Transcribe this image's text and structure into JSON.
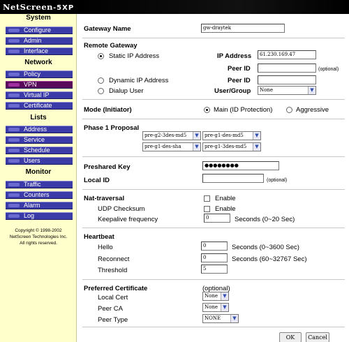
{
  "header": {
    "brand": "NetScreen",
    "model": "-5XP"
  },
  "sidebar": {
    "sections": [
      {
        "title": "System",
        "items": [
          "Configure",
          "Admin",
          "Interface"
        ]
      },
      {
        "title": "Network",
        "items": [
          "Policy",
          "VPN",
          "Virtual IP",
          "Certificate"
        ]
      },
      {
        "title": "Lists",
        "items": [
          "Address",
          "Service",
          "Schedule",
          "Users"
        ]
      },
      {
        "title": "Monitor",
        "items": [
          "Traffic",
          "Counters",
          "Alarm",
          "Log"
        ]
      }
    ],
    "active_item": "VPN",
    "copyright": [
      "Copyright © 1998-2002",
      "NetScreen Technologies Inc.",
      "All rights reserved."
    ]
  },
  "form": {
    "gateway_name_label": "Gateway Name",
    "gateway_name_value": "gw-draytek",
    "remote_gateway_label": "Remote Gateway",
    "static_ip_label": "Static IP Address",
    "ip_address_label": "IP Address",
    "ip_address_value": "61.230.169.47",
    "peer_id_label": "Peer ID",
    "optional_label": "(optional)",
    "dynamic_ip_label": "Dynamic IP Address",
    "peer_id_label_2": "Peer ID",
    "dialup_user_label": "Dialup User",
    "user_group_label": "User/Group",
    "user_group_value": "None",
    "mode_label": "Mode (Initiator)",
    "mode_main": "Main (ID Protection)",
    "mode_aggressive": "Aggressive",
    "phase1_label": "Phase 1 Proposal",
    "proposals": [
      "pre-g2-3des-md5",
      "pre-g1-des-md5",
      "pre-g1-des-sha",
      "pre-g1-3des-md5"
    ],
    "preshared_key_label": "Preshared Key",
    "preshared_key_value": "●●●●●●●●",
    "local_id_label": "Local ID",
    "local_id_optional": "(optional)",
    "nat_traversal_label": "Nat-traversal",
    "nat_enable": "Enable",
    "udp_checksum_label": "UDP Checksum",
    "udp_enable": "Enable",
    "keepalive_label": "Keepalive frequency",
    "keepalive_value": "0",
    "keepalive_units": "Seconds (0~20 Sec)",
    "heartbeat_label": "Heartbeat",
    "hello_label": "Hello",
    "hello_value": "0",
    "hello_units": "Seconds (0~3600 Sec)",
    "reconnect_label": "Reconnect",
    "reconnect_value": "0",
    "reconnect_units": "Seconds (60~32767 Sec)",
    "threshold_label": "Threshold",
    "threshold_value": "5",
    "pref_cert_label": "Preferred Certificate",
    "pref_cert_optional": "(optional)",
    "local_cert_label": "Local Cert",
    "local_cert_value": "None",
    "peer_ca_label": "Peer CA",
    "peer_ca_value": "None",
    "peer_type_label": "Peer Type",
    "peer_type_value": "NONE",
    "ok_label": "OK",
    "cancel_label": "Cancel"
  }
}
